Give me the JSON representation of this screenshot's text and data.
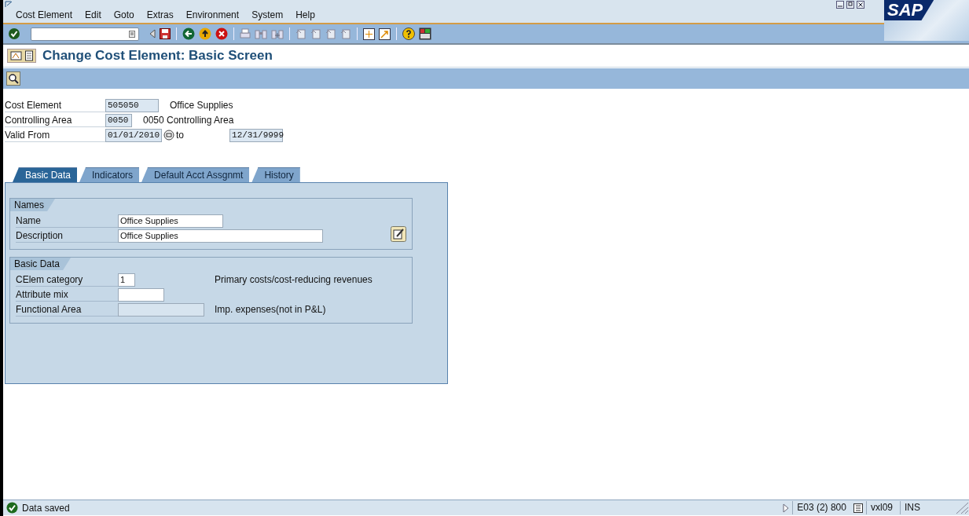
{
  "menu": [
    "Cost Element",
    "Edit",
    "Goto",
    "Extras",
    "Environment",
    "System",
    "Help"
  ],
  "logo": "SAP",
  "title": "Change Cost Element: Basic Screen",
  "header": [
    {
      "label": "Cost Element",
      "value": "505050",
      "text": "Office Supplies"
    },
    {
      "label": "Controlling Area",
      "value": "0050",
      "text": "0050 Controlling Area"
    },
    {
      "label": "Valid From",
      "value": "01/01/2010",
      "to_label": "to",
      "to_value": "12/31/9999"
    }
  ],
  "tabs": [
    {
      "label": "Basic Data",
      "selected": true
    },
    {
      "label": "Indicators",
      "selected": false
    },
    {
      "label": "Default Acct Assgnmt",
      "selected": false
    },
    {
      "label": "History",
      "selected": false
    }
  ],
  "groups": [
    {
      "title": "Names",
      "rows": [
        {
          "label": "Name",
          "value": "Office Supplies",
          "disabled": false
        },
        {
          "label": "Description",
          "value": "Office Supplies",
          "disabled": false
        }
      ]
    },
    {
      "title": "Basic Data",
      "rows": [
        {
          "label": "CElem category",
          "value": "1",
          "disabled": false,
          "text": "Primary costs/cost-reducing revenues"
        },
        {
          "label": "Attribute mix",
          "disabled": false
        },
        {
          "label": "Functional Area",
          "disabled": true,
          "text": "Imp. expenses(not in P&L)"
        }
      ]
    }
  ],
  "status": {
    "message": "Data saved",
    "system": "E03 (2) 800",
    "server": "vxl09",
    "mode": "INS"
  }
}
